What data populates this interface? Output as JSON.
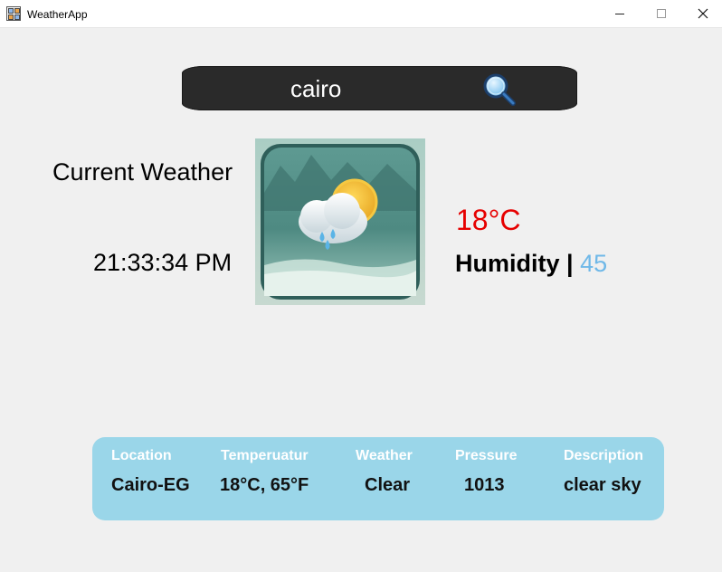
{
  "window": {
    "title": "WeatherApp",
    "minimize": "—",
    "maximize": "☐",
    "close": "✕",
    "icon": "app-grid-icon"
  },
  "search": {
    "value": "cairo",
    "icon": "search-icon"
  },
  "current": {
    "label": "Current Weather",
    "time": "21:33:34 PM",
    "image_icon": "cloud-sun-rain-icon"
  },
  "stats": {
    "temperature": "18°C",
    "humidity_label": "Humidity",
    "humidity_separator": "|",
    "humidity_value": "45"
  },
  "details": {
    "headers": [
      "Location",
      "Temperuatur",
      "Weather",
      "Pressure",
      "Description"
    ],
    "values": [
      "Cairo-EG",
      "18°C, 65°F",
      "Clear",
      "1013",
      "clear sky"
    ]
  },
  "colors": {
    "temperature": "#e60000",
    "humidity_value": "#6fb8e8",
    "card_background": "#9ad6e9",
    "search_background": "#2a2a2a"
  }
}
